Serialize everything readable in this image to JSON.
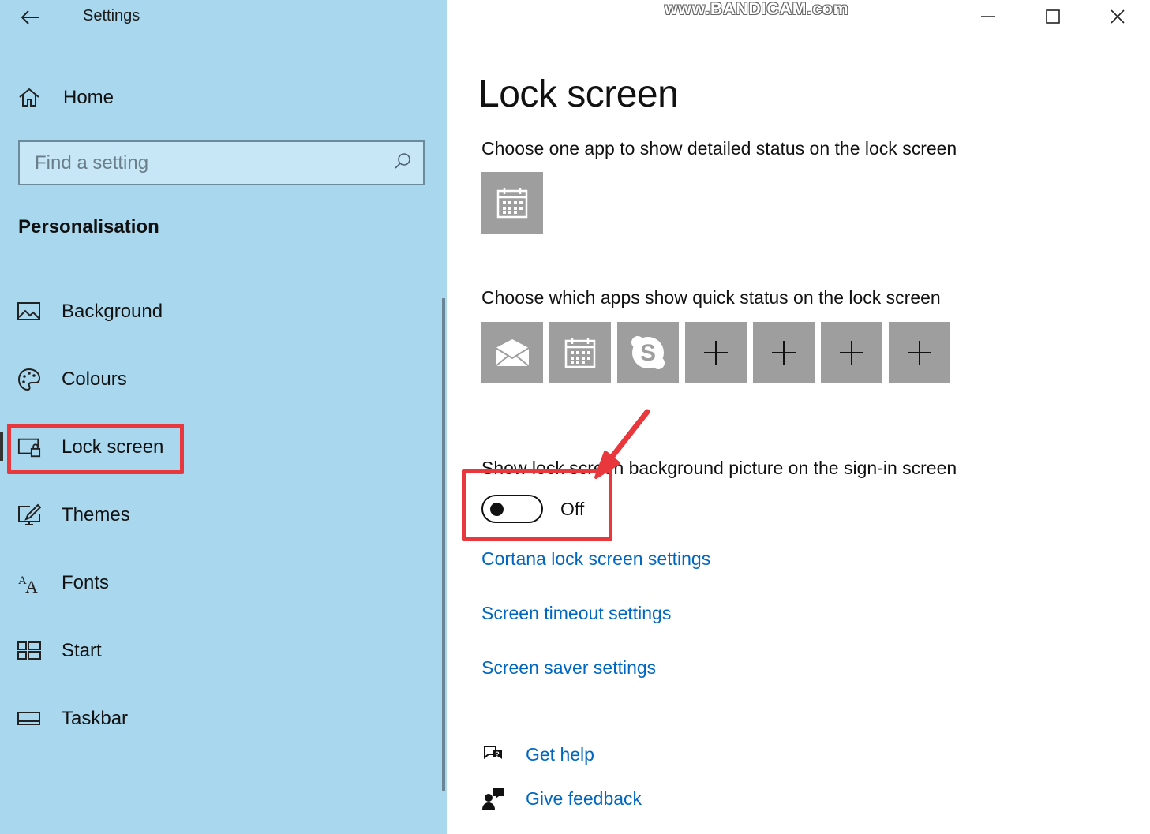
{
  "window": {
    "title": "Settings",
    "watermark": "www.BANDICAM.com"
  },
  "sidebar": {
    "home_label": "Home",
    "search_placeholder": "Find a setting",
    "section_heading": "Personalisation",
    "items": [
      {
        "label": "Background",
        "icon": "picture-icon"
      },
      {
        "label": "Colours",
        "icon": "palette-icon"
      },
      {
        "label": "Lock screen",
        "icon": "lock-screen-icon",
        "selected": true
      },
      {
        "label": "Themes",
        "icon": "themes-icon"
      },
      {
        "label": "Fonts",
        "icon": "fonts-icon"
      },
      {
        "label": "Start",
        "icon": "start-icon"
      },
      {
        "label": "Taskbar",
        "icon": "taskbar-icon"
      }
    ]
  },
  "main": {
    "title": "Lock screen",
    "detailed_status_label": "Choose one app to show detailed status on the lock screen",
    "quick_status_label": "Choose which apps show quick status on the lock screen",
    "quick_tiles": [
      "mail-icon",
      "calendar-icon",
      "skype-icon",
      "plus-icon",
      "plus-icon",
      "plus-icon",
      "plus-icon"
    ],
    "signin_picture_label": "Show lock screen background picture on the sign-in screen",
    "signin_picture_state": "Off",
    "links": {
      "cortana": "Cortana lock screen settings",
      "timeout": "Screen timeout settings",
      "saver": "Screen saver settings"
    },
    "help": {
      "get_help": "Get help",
      "give_feedback": "Give feedback"
    }
  },
  "colors": {
    "sidebar_bg": "#a9d7ee",
    "link": "#0067c0",
    "tile": "#9e9e9e",
    "annotation": "#e8383d"
  }
}
